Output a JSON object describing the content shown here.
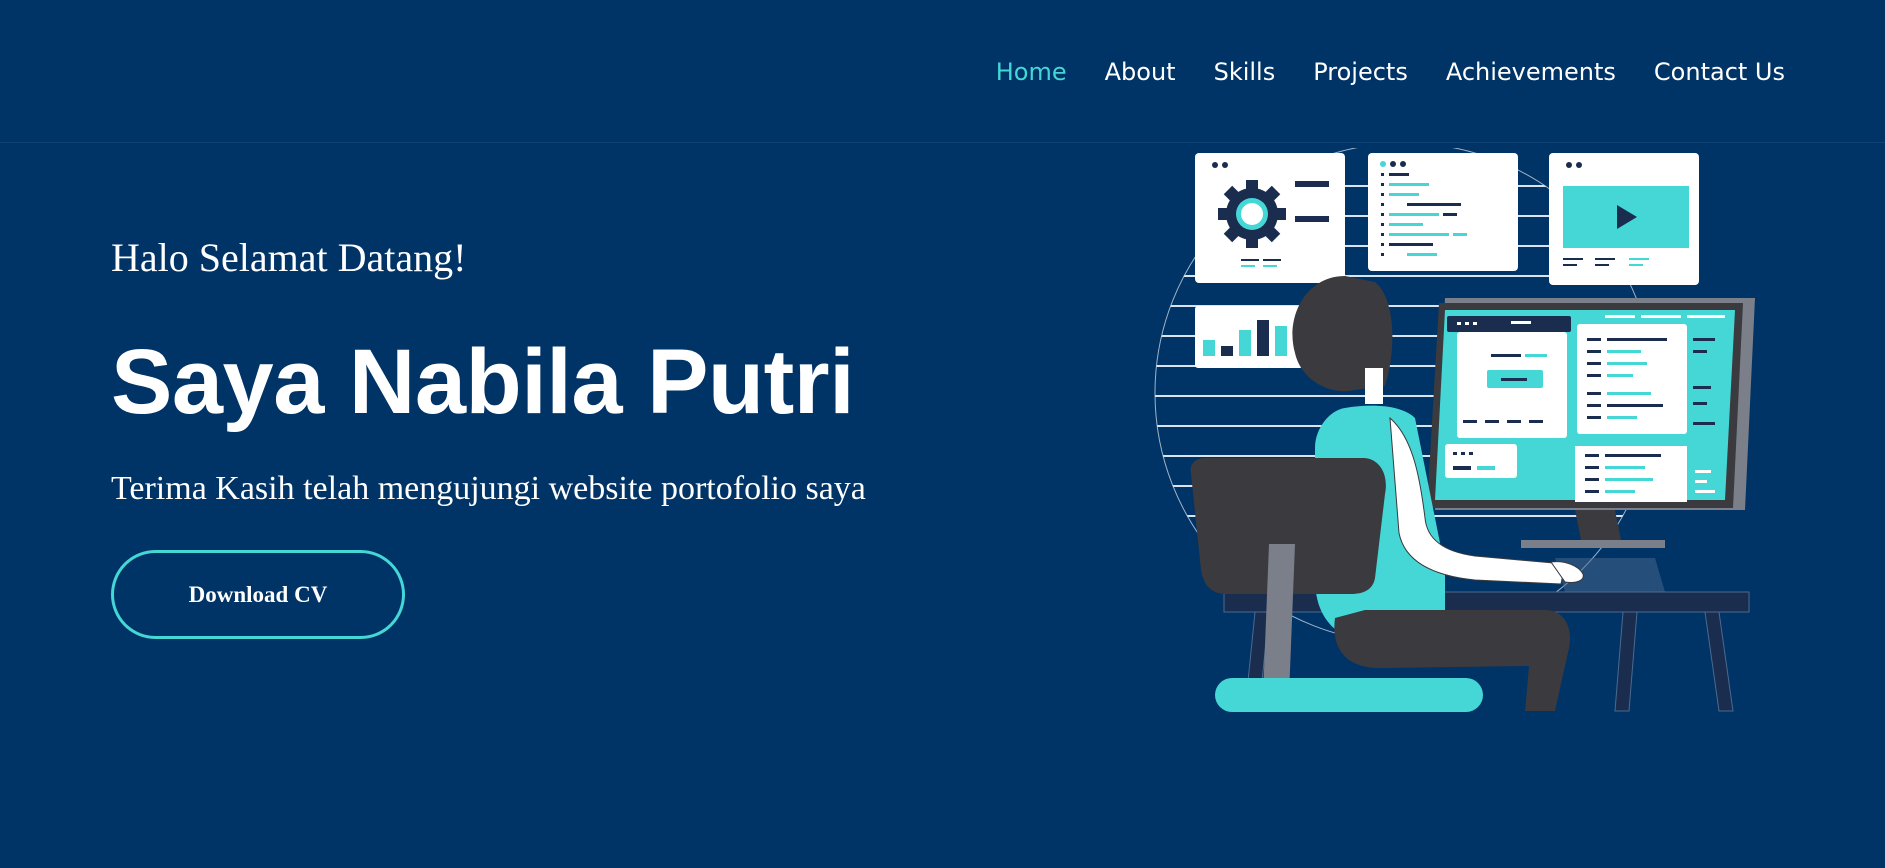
{
  "nav": {
    "items": [
      {
        "label": "Home",
        "active": true
      },
      {
        "label": "About",
        "active": false
      },
      {
        "label": "Skills",
        "active": false
      },
      {
        "label": "Projects",
        "active": false
      },
      {
        "label": "Achievements",
        "active": false
      },
      {
        "label": "Contact Us",
        "active": false
      }
    ]
  },
  "hero": {
    "greeting": "Halo Selamat Datang!",
    "name": "Saya Nabila Putri",
    "tagline": "Terima Kasih telah mengujungi website portofolio saya",
    "cv_button": "Download CV"
  },
  "colors": {
    "background": "#003366",
    "accent": "#44d7d6",
    "text": "#ffffff",
    "dark": "#3a3a3f"
  },
  "illustration": {
    "icon": "developer-at-computer-illustration"
  }
}
